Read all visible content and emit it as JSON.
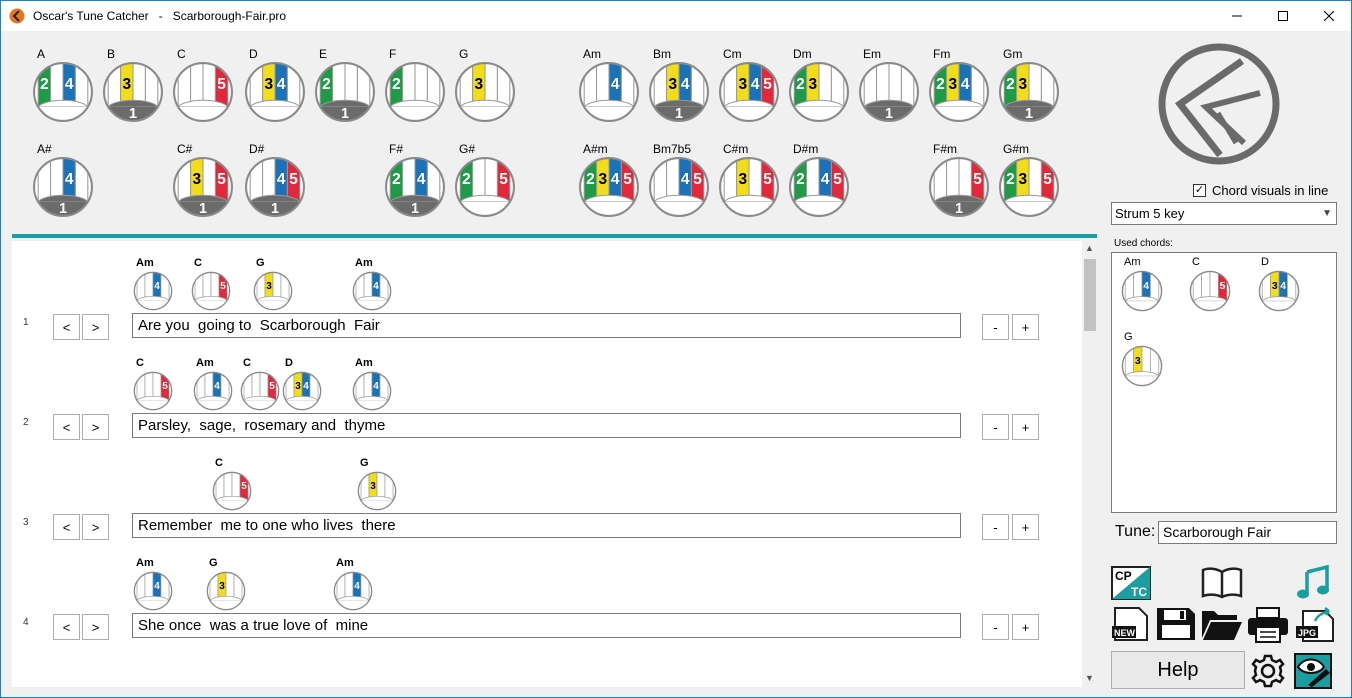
{
  "window": {
    "app_name": "Oscar's Tune Catcher",
    "separator": "-",
    "file_name": "Scarborough-Fair.pro"
  },
  "colors": {
    "green": "#1f9a47",
    "yellow": "#f3dc1a",
    "blue": "#1a72b8",
    "red": "#e2283a",
    "teal": "#1a9ea0",
    "gray": "#6b6b6b"
  },
  "chord_grid": {
    "row1": [
      {
        "name": "A",
        "keys": [
          2,
          4
        ],
        "base": false
      },
      {
        "name": "B",
        "keys": [
          3
        ],
        "base": true
      },
      {
        "name": "C",
        "keys": [
          5
        ],
        "base": false
      },
      {
        "name": "D",
        "keys": [
          3,
          4
        ],
        "base": false
      },
      {
        "name": "E",
        "keys": [
          2
        ],
        "base": true
      },
      {
        "name": "F",
        "keys": [
          2
        ],
        "base": false
      },
      {
        "name": "G",
        "keys": [
          3
        ],
        "base": false
      },
      {
        "name": "Am",
        "keys": [
          4
        ],
        "base": false
      },
      {
        "name": "Bm",
        "keys": [
          3,
          4
        ],
        "base": true
      },
      {
        "name": "Cm",
        "keys": [
          3,
          4,
          5
        ],
        "base": false
      },
      {
        "name": "Dm",
        "keys": [
          2,
          3
        ],
        "base": false
      },
      {
        "name": "Em",
        "keys": [],
        "base": true
      },
      {
        "name": "Fm",
        "keys": [
          2,
          3,
          4
        ],
        "base": false
      },
      {
        "name": "Gm",
        "keys": [
          2,
          3
        ],
        "base": true
      }
    ],
    "row2": [
      {
        "name": "A#",
        "keys": [
          4
        ],
        "base": true
      },
      {
        "name": "C#",
        "keys": [
          3,
          5
        ],
        "base": true
      },
      {
        "name": "D#",
        "keys": [
          4,
          5
        ],
        "base": true
      },
      {
        "name": "F#",
        "keys": [
          2,
          4
        ],
        "base": true
      },
      {
        "name": "G#",
        "keys": [
          2,
          5
        ],
        "base": false
      },
      {
        "name": "A#m",
        "keys": [
          2,
          3,
          4,
          5
        ],
        "base": false
      },
      {
        "name": "Bm7b5",
        "keys": [
          4,
          5
        ],
        "base": false
      },
      {
        "name": "C#m",
        "keys": [
          3,
          5
        ],
        "base": false
      },
      {
        "name": "D#m",
        "keys": [
          2,
          4,
          5
        ],
        "base": false
      },
      {
        "name": "F#m",
        "keys": [
          5
        ],
        "base": true
      },
      {
        "name": "G#m",
        "keys": [
          2,
          3,
          5
        ],
        "base": false
      }
    ]
  },
  "lyrics": {
    "lines": [
      {
        "num": "1",
        "text": "Are you  going to  Scarborough  Fair",
        "chords": [
          {
            "name": "Am",
            "keys": [
              4
            ]
          },
          {
            "name": "C",
            "keys": [
              5
            ]
          },
          {
            "name": "G",
            "keys": [
              3
            ]
          },
          {
            "name": "Am",
            "keys": [
              4
            ]
          }
        ]
      },
      {
        "num": "2",
        "text": "Parsley,  sage,  rosemary and  thyme",
        "chords": [
          {
            "name": "C",
            "keys": [
              5
            ]
          },
          {
            "name": "Am",
            "keys": [
              4
            ]
          },
          {
            "name": "C",
            "keys": [
              5
            ]
          },
          {
            "name": "D",
            "keys": [
              3,
              4
            ]
          },
          {
            "name": "Am",
            "keys": [
              4
            ]
          }
        ]
      },
      {
        "num": "3",
        "text": "Remember  me to one who lives  there",
        "chords": [
          {
            "name": "C",
            "keys": [
              5
            ]
          },
          {
            "name": "G",
            "keys": [
              3
            ]
          }
        ]
      },
      {
        "num": "4",
        "text": "She once  was a true love of  mine",
        "chords": [
          {
            "name": "Am",
            "keys": [
              4
            ]
          },
          {
            "name": "G",
            "keys": [
              3
            ]
          },
          {
            "name": "Am",
            "keys": [
              4
            ]
          }
        ]
      }
    ],
    "prev_label": "<",
    "next_label": ">",
    "minus_label": "-",
    "plus_label": "+"
  },
  "sidebar": {
    "chord_visuals_label": "Chord visuals in line",
    "chord_visuals_checked": true,
    "strum_select": "Strum 5 key",
    "used_chords_label": "Used chords:",
    "used_chords": [
      {
        "name": "Am",
        "keys": [
          4
        ]
      },
      {
        "name": "C",
        "keys": [
          5
        ]
      },
      {
        "name": "D",
        "keys": [
          3,
          4
        ]
      },
      {
        "name": "G",
        "keys": [
          3
        ]
      }
    ],
    "tune_label": "Tune:",
    "tune_value": "Scarborough Fair",
    "cp_tc_top": "CP",
    "cp_tc_bottom": "TC",
    "new_label": "NEW",
    "jpg_label": "JPG",
    "help_label": "Help"
  }
}
